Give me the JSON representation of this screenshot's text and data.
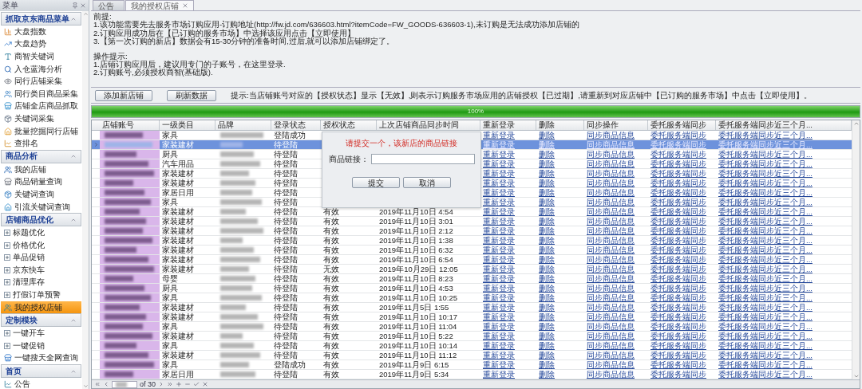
{
  "sidebar": {
    "title": "菜单",
    "groups": [
      {
        "title": "抓取京东商品菜单",
        "items": [
          {
            "label": "大盘指数",
            "kind": "tool",
            "selected": false
          },
          {
            "label": "大盘趋势",
            "kind": "tool",
            "selected": false
          },
          {
            "label": "商智关键词",
            "kind": "tool",
            "selected": false
          },
          {
            "label": "入仓蓝海分析",
            "kind": "tool",
            "selected": false
          },
          {
            "label": "同行店铺采集",
            "kind": "tool",
            "selected": false
          },
          {
            "label": "同行类目商品采集",
            "kind": "tool",
            "selected": false
          },
          {
            "label": "店铺全店商品抓取",
            "kind": "tool",
            "selected": false
          },
          {
            "label": "关键词采集",
            "kind": "tool",
            "selected": false
          },
          {
            "label": "批量挖掘同行店铺",
            "kind": "tool",
            "selected": false
          },
          {
            "label": "查排名",
            "kind": "tool",
            "selected": false
          }
        ]
      },
      {
        "title": "商品分析",
        "items": [
          {
            "label": "我的店铺",
            "kind": "tool",
            "selected": false
          },
          {
            "label": "商品销量查询",
            "kind": "tool",
            "selected": false
          },
          {
            "label": "关键词查询",
            "kind": "tool",
            "selected": false
          },
          {
            "label": "引流关键词查询",
            "kind": "tool",
            "selected": false
          }
        ]
      },
      {
        "title": "店铺商品优化",
        "items": [
          {
            "label": "标题优化",
            "kind": "expandable",
            "selected": false
          },
          {
            "label": "价格优化",
            "kind": "expandable",
            "selected": false
          },
          {
            "label": "单品促销",
            "kind": "expandable",
            "selected": false
          },
          {
            "label": "京东快车",
            "kind": "expandable",
            "selected": false
          },
          {
            "label": "清理库存",
            "kind": "expandable",
            "selected": false
          },
          {
            "label": "打假订单预警",
            "kind": "expandable",
            "selected": false
          },
          {
            "label": "我的授权店铺",
            "kind": "tool",
            "selected": true
          }
        ]
      },
      {
        "title": "定制模块",
        "items": [
          {
            "label": "一键开车",
            "kind": "expandable",
            "selected": false
          },
          {
            "label": "一键促销",
            "kind": "expandable",
            "selected": false
          },
          {
            "label": "一键搜天全网查询",
            "kind": "tool",
            "selected": false
          }
        ]
      },
      {
        "title": "首页",
        "items": [
          {
            "label": "公告",
            "kind": "tool",
            "selected": false
          }
        ]
      }
    ]
  },
  "tabs": [
    {
      "label": "公告",
      "selected": false,
      "closable": false
    },
    {
      "label": "我的授权店铺",
      "selected": true,
      "closable": true
    }
  ],
  "notes": [
    {
      "heading": "前提:",
      "lines": [
        "1.该功能需要先去服务市场订购应用-订购地址(http://fw.jd.com/636603.html?itemCode=FW_GOODS-636603-1),未订购是无法成功添加店铺的",
        "2.订购应用成功后在【已订购的服务市场】中选择该应用点击【立即使用】",
        "3.【第一次订购的新店】数据会有15-30分钟的准备时间,过后,就可以添加店铺绑定了。"
      ]
    },
    {
      "heading": "操作提示:",
      "lines": [
        "1.店铺订购应用后，建议用专门的子账号，在这里登录.",
        "2.订购账号,必须授权商智(基础版)."
      ]
    }
  ],
  "toolbar": {
    "buttons": [
      "添加新店铺",
      "刷新数据"
    ],
    "hint": "提示:当店铺账号对应的【授权状态】显示【无效】,则表示订购服务市场应用的店铺授权【已过期】,请重新到对应店铺中【已订购的服务市场】中点击【立即使用】。"
  },
  "progress": {
    "level": 1,
    "label": "100%"
  },
  "table": {
    "columns": [
      "店铺账号",
      "一级类目",
      "品牌",
      "登录状态",
      "授权状态",
      "上次店铺商品同步时间",
      "重新登录",
      "删除",
      "同步操作",
      "委托服务端同步",
      "委托服务端同步近三个月..."
    ],
    "rows": [
      {
        "selected": false,
        "category": "家具",
        "login": "登陆成功",
        "actions": [
          "重新登录",
          "删除",
          "同步商品信息",
          "委托服务端同步",
          "委托服务端同步近三个月..."
        ]
      },
      {
        "selected": true,
        "category": "家装建材",
        "login": "待登陆",
        "actions": [
          "重新登录",
          "删除",
          "同步商品信息",
          "委托服务端同步",
          "委托服务端同步近三个月..."
        ]
      },
      {
        "selected": false,
        "category": "厨具",
        "login": "待登陆",
        "actions": [
          "重新登录",
          "删除",
          "同步商品信息",
          "委托服务端同步",
          "委托服务端同步近三个月..."
        ]
      },
      {
        "selected": false,
        "category": "汽车用品",
        "login": "待登陆",
        "actions": [
          "重新登录",
          "删除",
          "同步商品信息",
          "委托服务端同步",
          "委托服务端同步近三个月..."
        ]
      },
      {
        "selected": false,
        "category": "家装建材",
        "login": "待登陆",
        "actions": [
          "重新登录",
          "删除",
          "同步商品信息",
          "委托服务端同步",
          "委托服务端同步近三个月..."
        ]
      },
      {
        "selected": false,
        "category": "家装建材",
        "login": "待登陆",
        "actions": [
          "重新登录",
          "删除",
          "同步商品信息",
          "委托服务端同步",
          "委托服务端同步近三个月..."
        ]
      },
      {
        "selected": false,
        "category": "家居日用",
        "login": "待登陆",
        "actions": [
          "重新登录",
          "删除",
          "同步商品信息",
          "委托服务端同步",
          "委托服务端同步近三个月..."
        ]
      },
      {
        "selected": false,
        "category": "家具",
        "login": "待登陆",
        "actions": [
          "重新登录",
          "删除",
          "同步商品信息",
          "委托服务端同步",
          "委托服务端同步近三个月..."
        ]
      },
      {
        "selected": false,
        "category": "家装建材",
        "login": "待登陆",
        "auth": "有效",
        "synced": "2019年11月10日 4:54",
        "actions": [
          "重新登录",
          "删除",
          "同步商品信息",
          "委托服务端同步",
          "委托服务端同步近三个月..."
        ]
      },
      {
        "selected": false,
        "category": "家装建材",
        "login": "待登陆",
        "auth": "有效",
        "synced": "2019年11月10日 3:01",
        "actions": [
          "重新登录",
          "删除",
          "同步商品信息",
          "委托服务端同步",
          "委托服务端同步近三个月..."
        ]
      },
      {
        "selected": false,
        "category": "家装建材",
        "login": "待登陆",
        "auth": "有效",
        "synced": "2019年11月10日 2:12",
        "actions": [
          "重新登录",
          "删除",
          "同步商品信息",
          "委托服务端同步",
          "委托服务端同步近三个月..."
        ]
      },
      {
        "selected": false,
        "category": "家装建材",
        "login": "待登陆",
        "auth": "有效",
        "synced": "2019年11月10日 1:38",
        "actions": [
          "重新登录",
          "删除",
          "同步商品信息",
          "委托服务端同步",
          "委托服务端同步近三个月..."
        ]
      },
      {
        "selected": false,
        "category": "家装建材",
        "login": "待登陆",
        "auth": "有效",
        "synced": "2019年11月10日 6:32",
        "actions": [
          "重新登录",
          "删除",
          "同步商品信息",
          "委托服务端同步",
          "委托服务端同步近三个月..."
        ]
      },
      {
        "selected": false,
        "category": "家装建材",
        "login": "待登陆",
        "auth": "有效",
        "synced": "2019年11月10日 6:54",
        "actions": [
          "重新登录",
          "删除",
          "同步商品信息",
          "委托服务端同步",
          "委托服务端同步近三个月..."
        ]
      },
      {
        "selected": false,
        "category": "家装建材",
        "login": "待登陆",
        "auth": "无效",
        "synced": "2019年10月29日 12:05",
        "actions": [
          "重新登录",
          "删除",
          "同步商品信息",
          "委托服务端同步",
          "委托服务端同步近三个月..."
        ]
      },
      {
        "selected": false,
        "category": "母婴",
        "login": "待登陆",
        "auth": "有效",
        "synced": "2019年11月10日 8:23",
        "actions": [
          "重新登录",
          "删除",
          "同步商品信息",
          "委托服务端同步",
          "委托服务端同步近三个月..."
        ]
      },
      {
        "selected": false,
        "category": "厨具",
        "login": "待登陆",
        "auth": "有效",
        "synced": "2019年11月10日 4:53",
        "actions": [
          "重新登录",
          "删除",
          "同步商品信息",
          "委托服务端同步",
          "委托服务端同步近三个月..."
        ]
      },
      {
        "selected": false,
        "category": "家具",
        "login": "待登陆",
        "auth": "有效",
        "synced": "2019年11月10日 10:25",
        "actions": [
          "重新登录",
          "删除",
          "同步商品信息",
          "委托服务端同步",
          "委托服务端同步近三个月..."
        ]
      },
      {
        "selected": false,
        "category": "家装建材",
        "login": "待登陆",
        "auth": "有效",
        "synced": "2019年11月5日 1:55",
        "actions": [
          "重新登录",
          "删除",
          "同步商品信息",
          "委托服务端同步",
          "委托服务端同步近三个月..."
        ]
      },
      {
        "selected": false,
        "category": "家装建材",
        "login": "待登陆",
        "auth": "有效",
        "synced": "2019年11月10日 10:17",
        "actions": [
          "重新登录",
          "删除",
          "同步商品信息",
          "委托服务端同步",
          "委托服务端同步近三个月..."
        ]
      },
      {
        "selected": false,
        "category": "家具",
        "login": "待登陆",
        "auth": "有效",
        "synced": "2019年11月10日 11:04",
        "actions": [
          "重新登录",
          "删除",
          "同步商品信息",
          "委托服务端同步",
          "委托服务端同步近三个月..."
        ]
      },
      {
        "selected": false,
        "category": "家装建材",
        "login": "待登陆",
        "auth": "有效",
        "synced": "2019年11月10日 5:22",
        "actions": [
          "重新登录",
          "删除",
          "同步商品信息",
          "委托服务端同步",
          "委托服务端同步近三个月..."
        ]
      },
      {
        "selected": false,
        "category": "家具",
        "login": "待登陆",
        "auth": "有效",
        "synced": "2019年11月10日 10:14",
        "actions": [
          "重新登录",
          "删除",
          "同步商品信息",
          "委托服务端同步",
          "委托服务端同步近三个月..."
        ]
      },
      {
        "selected": false,
        "category": "家装建材",
        "login": "待登陆",
        "auth": "有效",
        "synced": "2019年11月10日 11:12",
        "actions": [
          "重新登录",
          "删除",
          "同步商品信息",
          "委托服务端同步",
          "委托服务端同步近三个月..."
        ]
      },
      {
        "selected": false,
        "category": "家具",
        "login": "登陆成功",
        "auth": "有效",
        "synced": "2019年11月9日 6:15",
        "actions": [
          "重新登录",
          "删除",
          "同步商品信息",
          "委托服务端同步",
          "委托服务端同步近三个月..."
        ]
      },
      {
        "selected": false,
        "category": "家居日用",
        "login": "待登陆",
        "auth": "有效",
        "synced": "2019年11月9日 5:34",
        "actions": [
          "重新登录",
          "删除",
          "同步商品信息",
          "委托服务端同步",
          "委托服务端同步近三个月..."
        ]
      }
    ]
  },
  "dialog": {
    "title": "请提交一个，该新店的商品链接",
    "field_label": "商品链接：",
    "buttons": [
      "提交",
      "取消"
    ]
  },
  "pager": {
    "total": "of 30"
  }
}
